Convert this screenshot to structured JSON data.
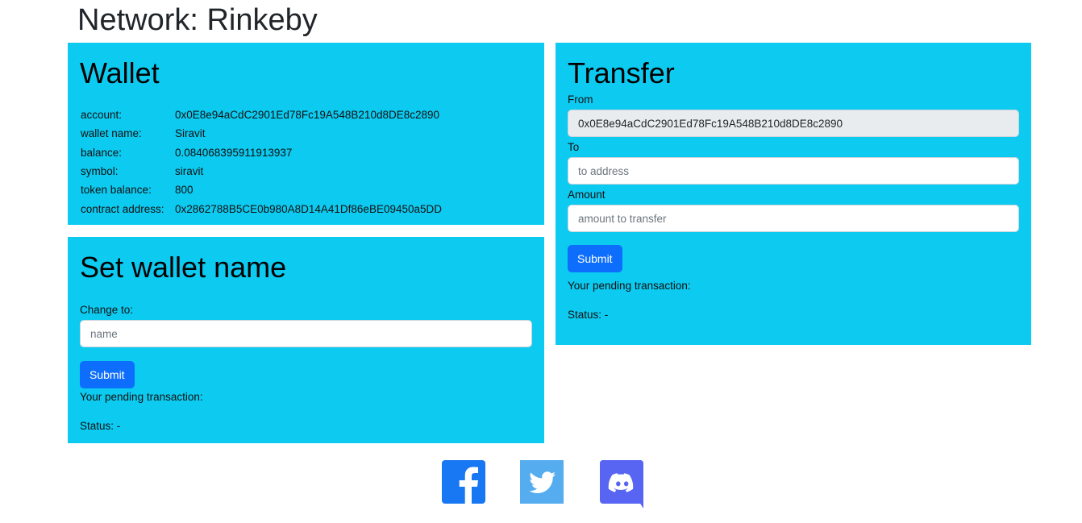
{
  "network": {
    "title": "Network: Rinkeby"
  },
  "wallet": {
    "heading": "Wallet",
    "rows": [
      {
        "key": "account:",
        "value": "0x0E8e94aCdC2901Ed78Fc19A548B210d8DE8c2890"
      },
      {
        "key": "wallet name:",
        "value": "Siravit"
      },
      {
        "key": "balance:",
        "value": "0.084068395911913937"
      },
      {
        "key": "symbol:",
        "value": "siravit"
      },
      {
        "key": "token balance:",
        "value": "800"
      },
      {
        "key": "contract address:",
        "value": "0x2862788B5CE0b980A8D14A41Df86eBE09450a5DD"
      }
    ]
  },
  "set_name": {
    "heading": "Set wallet name",
    "change_label": "Change to:",
    "name_placeholder": "name",
    "submit_label": "Submit",
    "pending_text": "Your pending transaction:",
    "status_text": "Status: -"
  },
  "transfer": {
    "heading": "Transfer",
    "from_label": "From",
    "from_value": "0x0E8e94aCdC2901Ed78Fc19A548B210d8DE8c2890",
    "to_label": "To",
    "to_placeholder": "to address",
    "amount_label": "Amount",
    "amount_placeholder": "amount to transfer",
    "submit_label": "Submit",
    "pending_text": "Your pending transaction:",
    "status_text": "Status: -"
  },
  "social": {
    "icons": [
      "facebook-icon",
      "twitter-icon",
      "discord-icon"
    ],
    "colors": {
      "facebook": "#1877f2",
      "twitter": "#55acee",
      "discord": "#5865f2"
    }
  },
  "colors": {
    "card": "#0dcaf0",
    "button": "#0d6efd"
  }
}
